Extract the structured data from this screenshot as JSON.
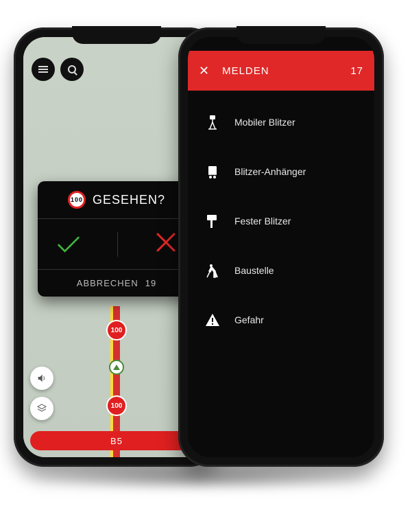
{
  "left": {
    "panel": {
      "speed": "100",
      "title": "GESEHEN?",
      "cancel": "ABBRECHEN",
      "countdown": "19"
    },
    "road_label": "B5",
    "pins": [
      "100",
      "100"
    ]
  },
  "right": {
    "header": {
      "title": "MELDEN",
      "countdown": "17"
    },
    "menu": [
      {
        "label": "Mobiler Blitzer",
        "icon": "tripod-camera-icon"
      },
      {
        "label": "Blitzer-Anhänger",
        "icon": "trailer-icon"
      },
      {
        "label": "Fester Blitzer",
        "icon": "fixed-camera-icon"
      },
      {
        "label": "Baustelle",
        "icon": "construction-icon"
      },
      {
        "label": "Gefahr",
        "icon": "warning-icon"
      }
    ]
  }
}
